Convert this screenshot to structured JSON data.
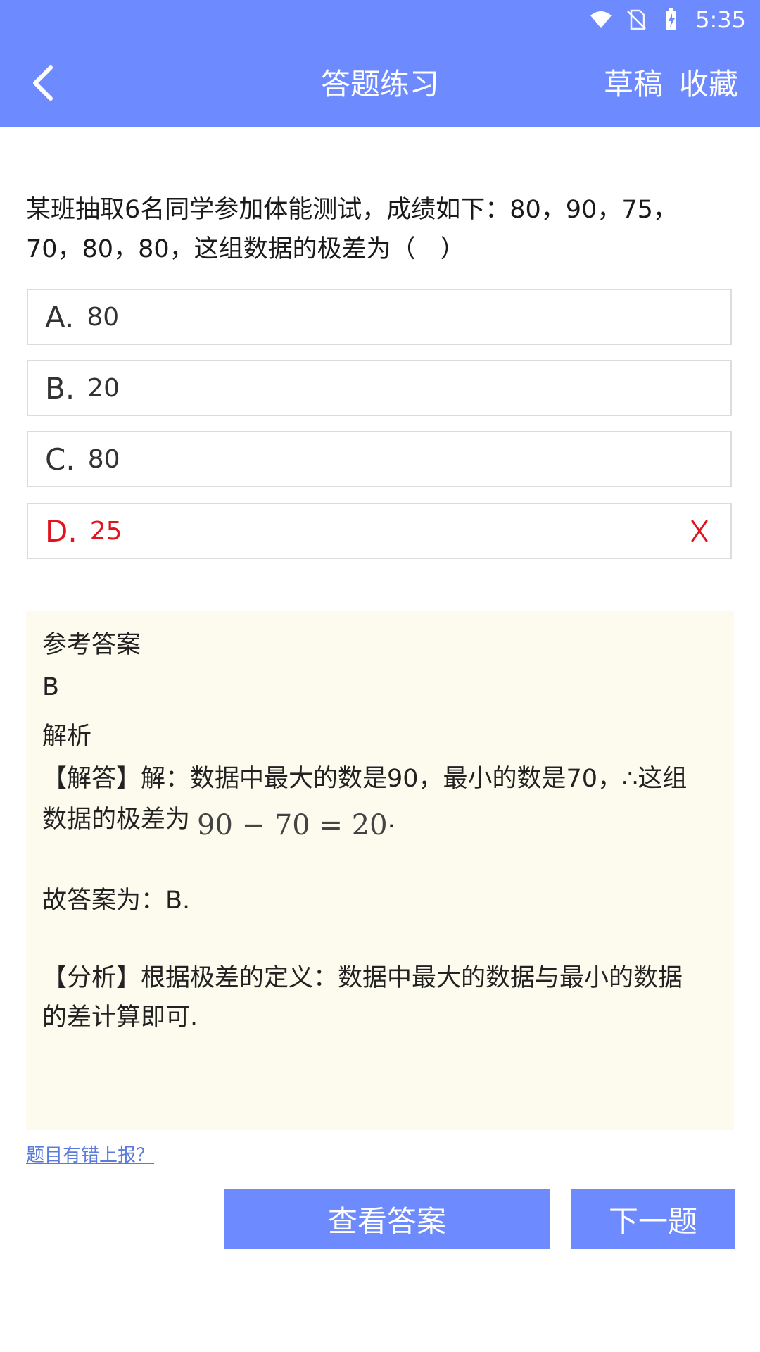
{
  "status_bar": {
    "time": "5:35"
  },
  "header": {
    "title": "答题练习",
    "draft_label": "草稿",
    "favorite_label": "收藏"
  },
  "question": {
    "line1": "某班抽取6名同学参加体能测试，成绩如下：80，90，75，",
    "line2": "70，80，80，这组数据的极差为（　）"
  },
  "options": [
    {
      "letter": "A.",
      "value": "80"
    },
    {
      "letter": "B.",
      "value": "20"
    },
    {
      "letter": "C.",
      "value": "80"
    },
    {
      "letter": "D.",
      "value": "25"
    }
  ],
  "answer": {
    "ref_title": "参考答案",
    "ref_value": "B",
    "analysis_title": "解析",
    "solution_line1": "【解答】解：数据中最大的数是90，最小的数是70，∴这组",
    "solution_line2": "数据的极差为",
    "formula": "90 − 70 = 20",
    "formula_end": ".",
    "conclusion": "故答案为：B.",
    "analysis_line1": "【分析】根据极差的定义：数据中最大的数据与最小的数据",
    "analysis_line2": "的差计算即可."
  },
  "report_link": "题目有错上报？",
  "buttons": {
    "view_answer": "查看答案",
    "next": "下一题"
  },
  "colors": {
    "accent": "#6d8afe",
    "wrong": "#e0141e",
    "answer_bg": "#fdfbee",
    "link": "#5b7bdc"
  }
}
